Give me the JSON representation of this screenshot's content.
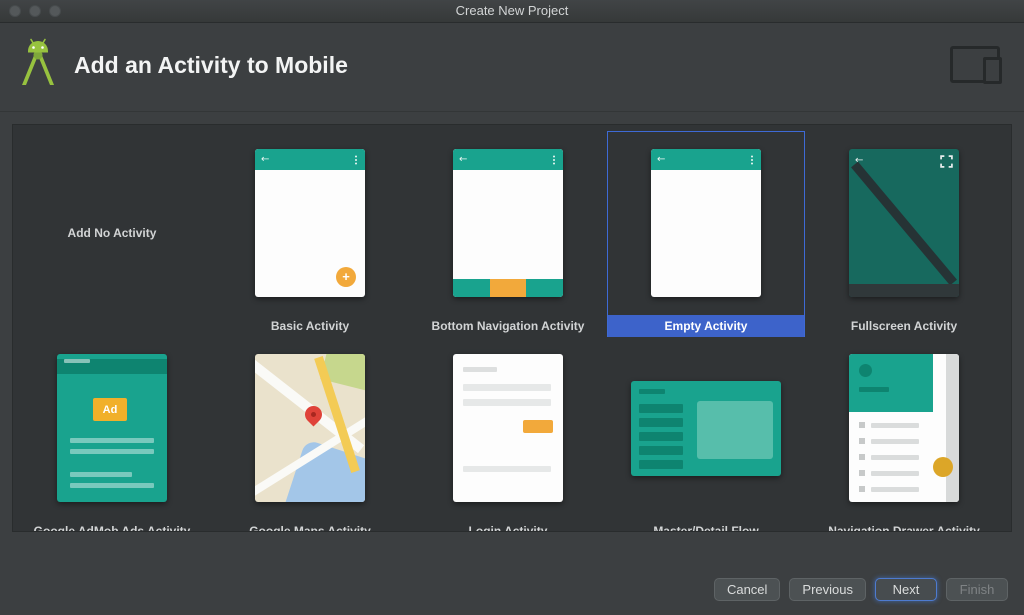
{
  "window": {
    "title": "Create New Project"
  },
  "header": {
    "title": "Add an Activity to Mobile"
  },
  "gallery": {
    "templates": [
      {
        "label": "Add No Activity",
        "selected": false
      },
      {
        "label": "Basic Activity",
        "selected": false
      },
      {
        "label": "Bottom Navigation Activity",
        "selected": false
      },
      {
        "label": "Empty Activity",
        "selected": true
      },
      {
        "label": "Fullscreen Activity",
        "selected": false
      },
      {
        "label": "Google AdMob Ads Activity",
        "selected": false
      },
      {
        "label": "Google Maps Activity",
        "selected": false
      },
      {
        "label": "Login Activity",
        "selected": false
      },
      {
        "label": "Master/Detail Flow",
        "selected": false
      },
      {
        "label": "Navigation Drawer Activity",
        "selected": false
      }
    ],
    "ad_badge": "Ad"
  },
  "icons": {
    "back_arrow": "←",
    "plus": "+"
  },
  "footer": {
    "buttons": [
      {
        "label": "Cancel",
        "enabled": true
      },
      {
        "label": "Previous",
        "enabled": true
      },
      {
        "label": "Next",
        "enabled": true,
        "default": true
      },
      {
        "label": "Finish",
        "enabled": false
      }
    ]
  },
  "colors": {
    "teal": "#19A38E",
    "amber": "#F2A93B",
    "selection_blue": "#3D63CA",
    "header_bg": "#3C3F41",
    "panel_bg": "#313436"
  }
}
